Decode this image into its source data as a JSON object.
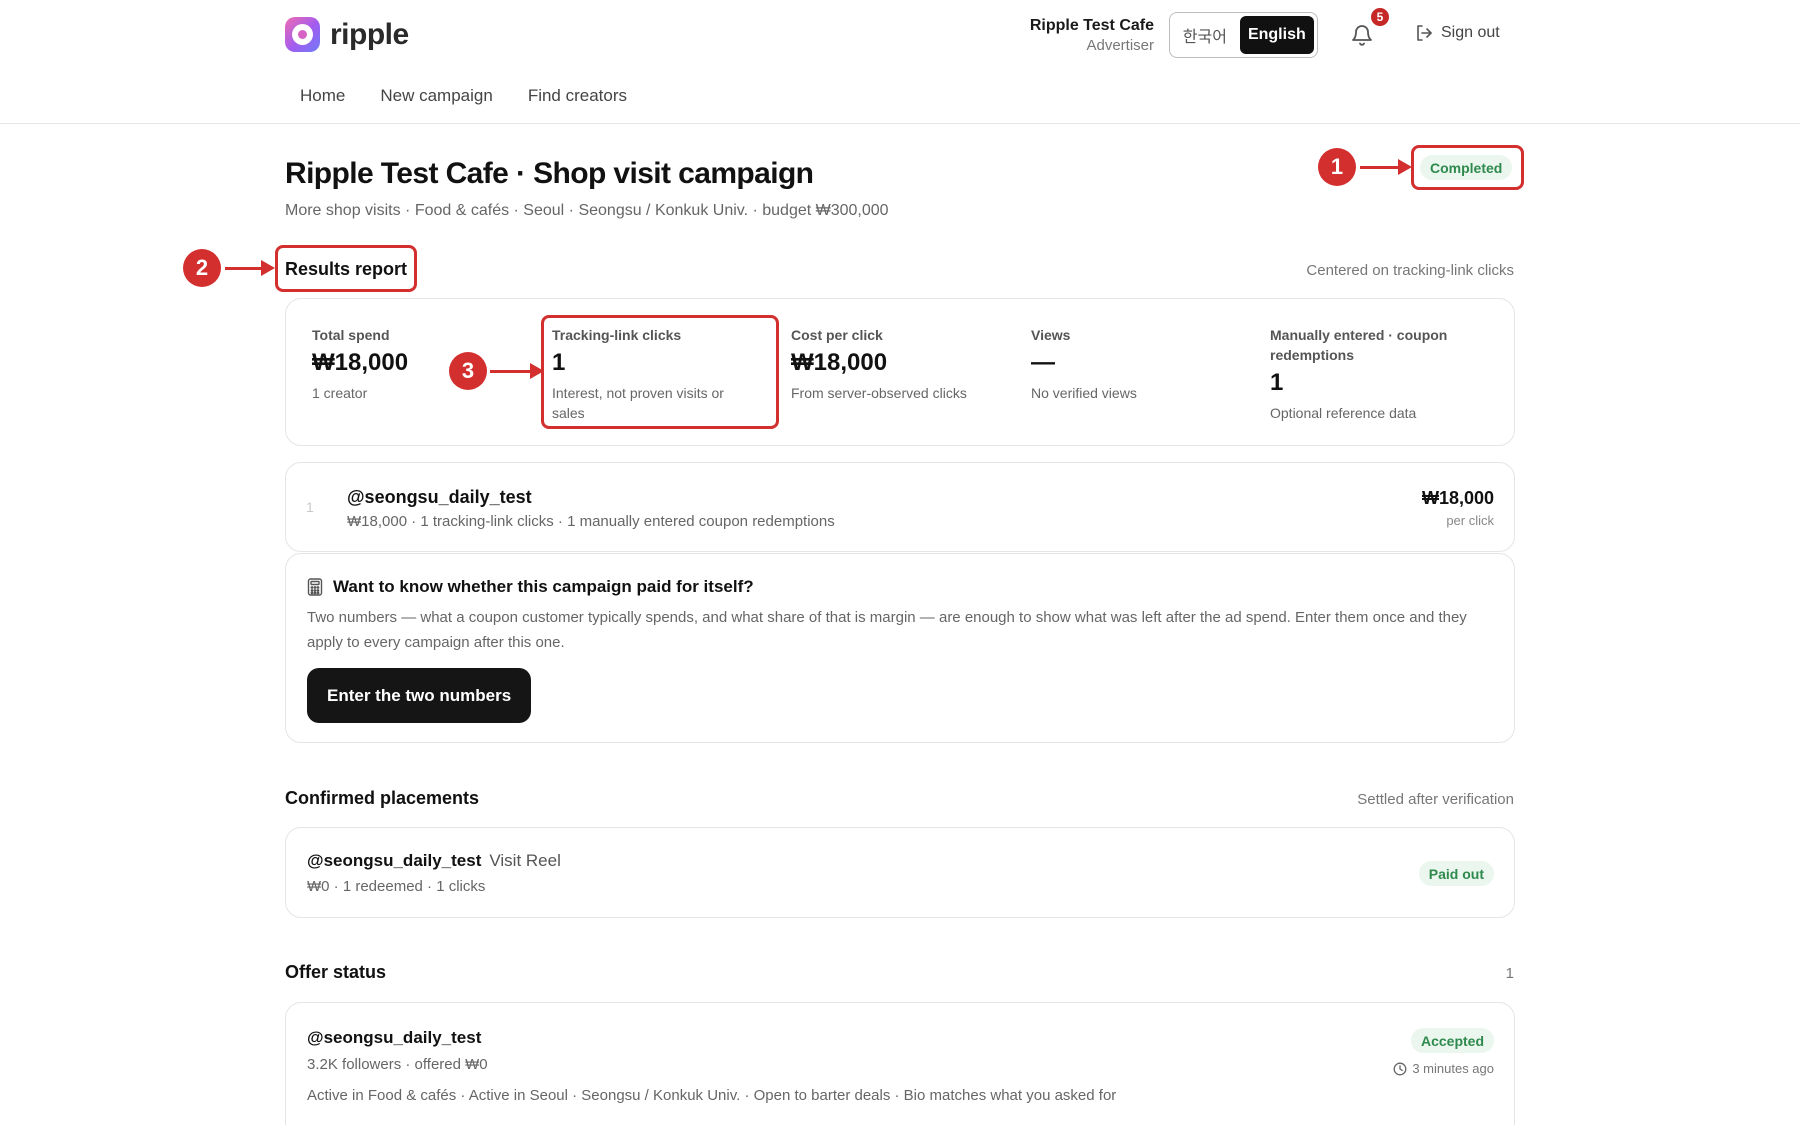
{
  "brand": {
    "name": "ripple"
  },
  "header": {
    "user_name": "Ripple Test Cafe",
    "user_role": "Advertiser",
    "lang_ko": "한국어",
    "lang_en": "English",
    "notification_count": "5",
    "sign_out": "Sign out"
  },
  "nav": {
    "home": "Home",
    "new_campaign": "New campaign",
    "find_creators": "Find creators"
  },
  "campaign": {
    "title": "Ripple Test Cafe · Shop visit campaign",
    "subtitle": "More shop visits · Food & cafés · Seoul · Seongsu / Konkuk Univ. · budget ₩300,000",
    "status": "Completed"
  },
  "annotations": {
    "one": "1",
    "two": "2",
    "three": "3"
  },
  "results": {
    "heading": "Results report",
    "note": "Centered on tracking-link clicks",
    "metrics": [
      {
        "label": "Total spend",
        "value": "₩18,000",
        "sub": "1 creator"
      },
      {
        "label": "Tracking-link clicks",
        "value": "1",
        "sub": "Interest, not proven visits or sales"
      },
      {
        "label": "Cost per click",
        "value": "₩18,000",
        "sub": "From server-observed clicks"
      },
      {
        "label": "Views",
        "value": "—",
        "sub": "No verified views"
      },
      {
        "label": "Manually entered · coupon redemptions",
        "value": "1",
        "sub": "Optional reference data"
      }
    ]
  },
  "creator_row": {
    "index": "1",
    "handle": "@seongsu_daily_test",
    "meta": "₩18,000 · 1 tracking-link clicks · 1 manually entered coupon redemptions",
    "price": "₩18,000",
    "price_sub": "per click"
  },
  "roi": {
    "title": "Want to know whether this campaign paid for itself?",
    "body": "Two numbers — what a coupon customer typically spends, and what share of that is margin — are enough to show what was left after the ad spend. Enter them once and they apply to every campaign after this one.",
    "button": "Enter the two numbers"
  },
  "placements": {
    "heading": "Confirmed placements",
    "note": "Settled after verification",
    "items": [
      {
        "handle": "@seongsu_daily_test",
        "type": "Visit Reel",
        "meta": "₩0 · 1 redeemed · 1 clicks",
        "status": "Paid out"
      }
    ]
  },
  "offers": {
    "heading": "Offer status",
    "count": "1",
    "items": [
      {
        "handle": "@seongsu_daily_test",
        "meta": "3.2K followers · offered ₩0",
        "tags": "Active in Food & cafés · Active in Seoul · Seongsu / Konkuk Univ. · Open to barter deals · Bio matches what you asked for",
        "status": "Accepted",
        "time": "3 minutes ago"
      }
    ]
  },
  "colors": {
    "accent_red": "#d32f2f",
    "success_green": "#2f8a4d",
    "success_bg": "#eaf6ee",
    "dark_button": "#151515"
  }
}
